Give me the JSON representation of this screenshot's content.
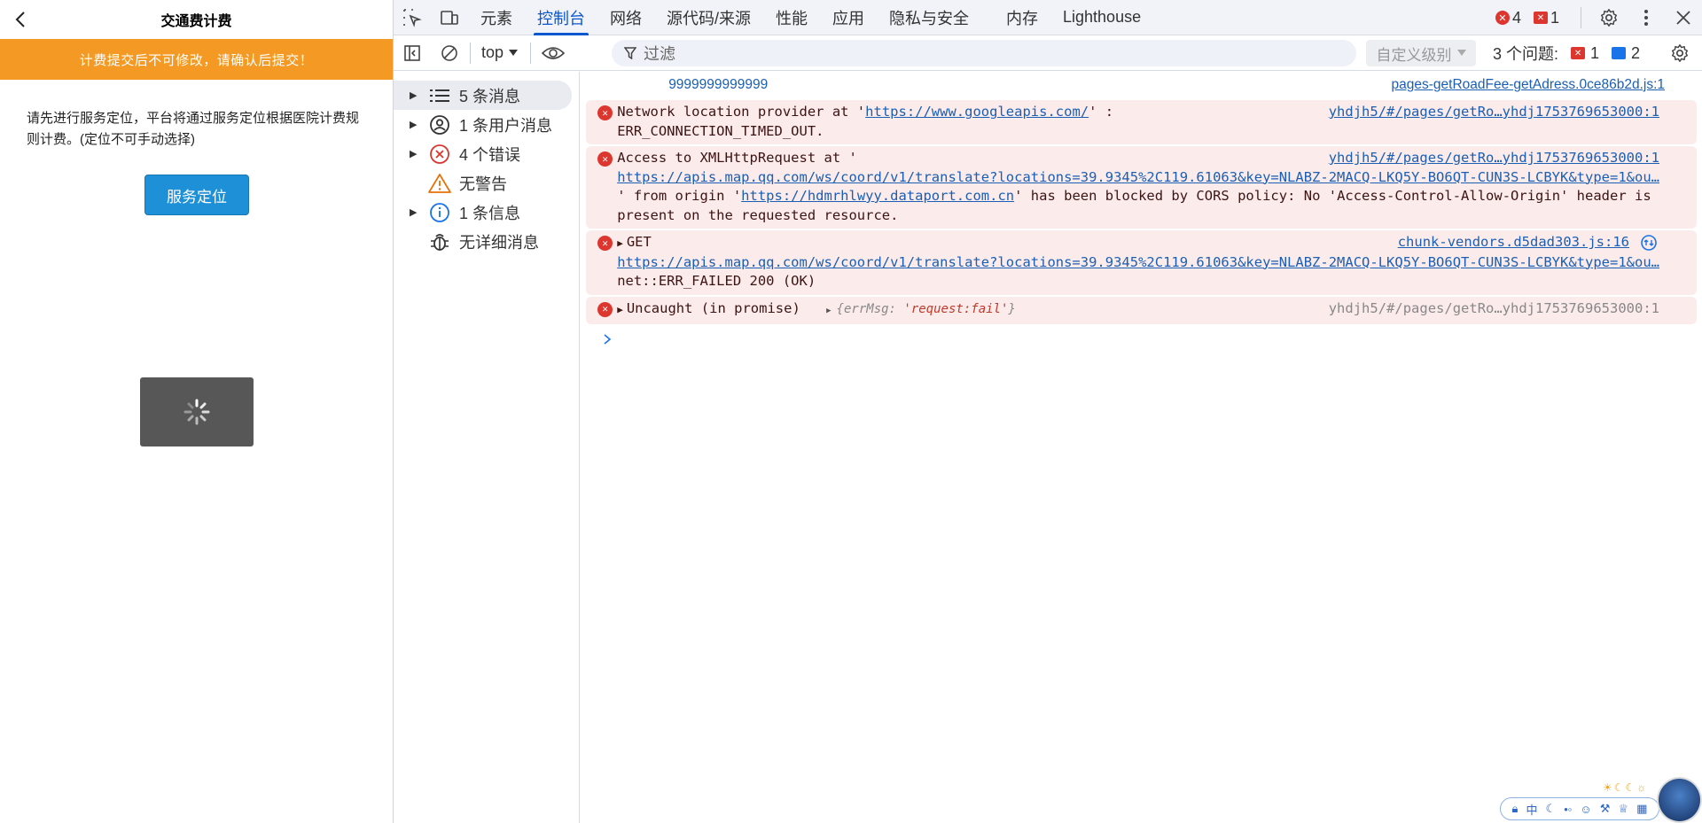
{
  "app": {
    "title": "交通费计费",
    "notice": "计费提交后不可修改，请确认后提交！",
    "description": "请先进行服务定位，平台将通过服务定位根据医院计费规则计费。(定位不可手动选择)",
    "locate_button": "服务定位"
  },
  "devtools": {
    "tabs": [
      {
        "label": "元素"
      },
      {
        "label": "控制台"
      },
      {
        "label": "网络"
      },
      {
        "label": "源代码/来源"
      },
      {
        "label": "性能"
      },
      {
        "label": "应用"
      },
      {
        "label": "隐私与安全"
      },
      {
        "label": "内存"
      },
      {
        "label": "Lighthouse"
      }
    ],
    "error_count": "4",
    "issue_flag_count": "1",
    "toolbar": {
      "context": "top",
      "filter_placeholder": "过滤",
      "levels": "自定义级别",
      "issues_label": "3 个问题:",
      "issues_error": "1",
      "issues_info": "2"
    },
    "sidebar": [
      {
        "label": "5 条消息"
      },
      {
        "label": "1 条用户消息"
      },
      {
        "label": "4 个错误"
      },
      {
        "label": "无警告"
      },
      {
        "label": "1 条信息"
      },
      {
        "label": "无详细消息"
      }
    ],
    "console": {
      "log1": {
        "text": "9999999999999",
        "source": "pages-getRoadFee-getAdress.0ce86b2d.js:1"
      },
      "err1": {
        "prefix": "Network location provider at '",
        "link": "https://www.googleapis.com/",
        "suffix": "' :",
        "line2": "ERR_CONNECTION_TIMED_OUT.",
        "source": "yhdjh5/#/pages/getRo…yhdj1753769653000:1"
      },
      "err2": {
        "prefix": "Access to XMLHttpRequest at '",
        "link": "https://apis.map.qq.com/ws/coord/v1/translate?locations=39.9345%2C119.61063&key=NLABZ-2MACQ-LKQ5Y-BO6QT-CUN3S-LCBYK&type=1&ou…",
        "mid": "' from origin '",
        "origin": "https://hdmrhlwyy.dataport.com.cn",
        "rest": "' has been blocked by CORS policy: No 'Access-Control-Allow-Origin' header is present on the requested resource.",
        "source": "yhdjh5/#/pages/getRo…yhdj1753769653000:1"
      },
      "err3": {
        "method": "GET",
        "link": "https://apis.map.qq.com/ws/coord/v1/translate?locations=39.9345%2C119.61063&key=NLABZ-2MACQ-LKQ5Y-BO6QT-CUN3S-LCBYK&type=1&ou…",
        "line3": "net::ERR_FAILED 200 (OK)",
        "source": "chunk-vendors.d5dad303.js:16"
      },
      "err4": {
        "text": "Uncaught (in promise)",
        "obj_key": "{errMsg: ",
        "obj_val": "'request:fail'",
        "obj_end": "}",
        "source": "yhdjh5/#/pages/getRo…yhdj1753769653000:1"
      }
    }
  },
  "ime": {
    "lang": "中"
  },
  "colors": {
    "notice_bg": "#f49a24",
    "button_bg": "#1e90d8",
    "accent": "#0b57d0",
    "error_row_bg": "#fcebeb",
    "error_red": "#dc362e"
  }
}
